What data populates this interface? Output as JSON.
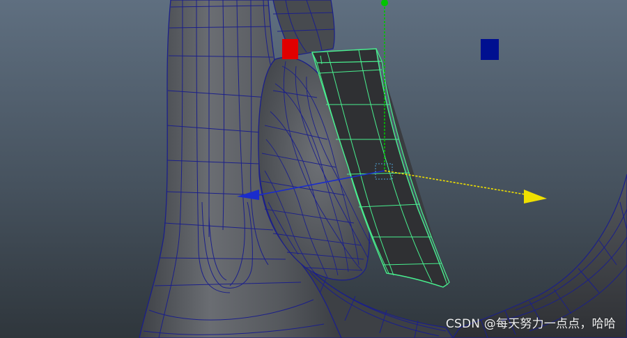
{
  "viewport": {
    "colors": {
      "background_top": "#5f6f80",
      "background_bottom": "#2f363c",
      "mesh_fill": "#5a5d62",
      "wireframe": "#1b1f8a",
      "selection_wire": "#49f08f",
      "selected_face": "#2f3033",
      "manip_x": "#f0e000",
      "manip_y": "#00c400",
      "manip_z": "#1a2ccc",
      "scale_handle": "#e00000",
      "light_marker": "#001090"
    },
    "icons": {
      "move_manip_x": "yellow-cone-arrow-icon",
      "move_manip_y": "green-sphere-handle-icon",
      "move_manip_z": "blue-cone-arrow-icon",
      "red_handle": "red-square-icon",
      "blue_marker": "blue-square-icon"
    }
  },
  "watermark": "CSDN @每天努力一点点，哈哈"
}
